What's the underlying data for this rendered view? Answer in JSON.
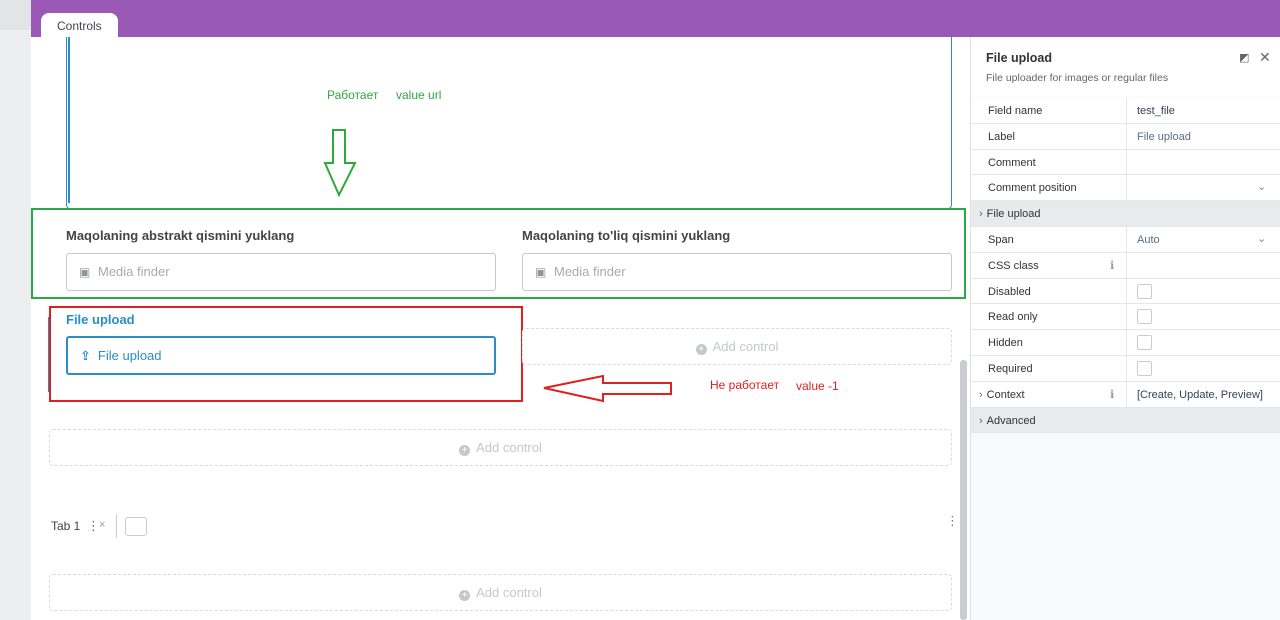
{
  "tabs": {
    "controls": "Controls"
  },
  "annotations": {
    "works": "Работает",
    "works_value": "value url",
    "not_works": "Не работает",
    "not_works_value": "value -1"
  },
  "fields": {
    "abstract_label": "Maqolaning abstrakt qismini yuklang",
    "abstract_placeholder": "Media finder",
    "full_label": "Maqolaning to'liq qismini yuklang",
    "full_placeholder": "Media finder",
    "file_upload_label": "File upload",
    "file_upload_button": "File upload"
  },
  "add_control": "Add control",
  "tab1": {
    "label": "Tab 1",
    "close": "×"
  },
  "panel": {
    "title": "File upload",
    "description": "File uploader for images or regular files",
    "rows": [
      {
        "key": "Field name",
        "value": "test_file"
      },
      {
        "key": "Label",
        "value": "File upload"
      },
      {
        "key": "Comment",
        "value": ""
      },
      {
        "key": "Comment position",
        "value": ""
      },
      {
        "key": "File upload",
        "group": true
      },
      {
        "key": "Span",
        "value": "Auto"
      },
      {
        "key": "CSS class",
        "value": ""
      },
      {
        "key": "Disabled",
        "value": ""
      },
      {
        "key": "Read only",
        "value": ""
      },
      {
        "key": "Hidden",
        "value": ""
      },
      {
        "key": "Required",
        "value": ""
      },
      {
        "key": "Context",
        "value": "[Create, Update, Preview]"
      },
      {
        "key": "Advanced",
        "group": true
      }
    ]
  },
  "colors": {
    "topbar": "#9b59b6",
    "accent": "#2b8dc5",
    "green_annotation": "#2aa84a",
    "red_annotation": "#e02020"
  }
}
